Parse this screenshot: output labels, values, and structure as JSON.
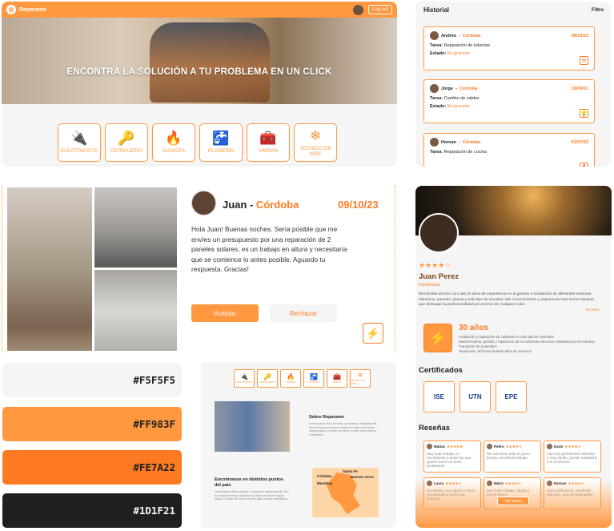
{
  "hero": {
    "brand": "Reparame",
    "logout": "Log out",
    "headline": "ENCONTRA LA SOLUCIÓN A TU PROBLEMA EN UN CLICK",
    "categories": [
      {
        "label": "ELECTRICISTA",
        "icon": "plug-icon",
        "glyph": "🔌"
      },
      {
        "label": "CERRAJERO",
        "icon": "key-icon",
        "glyph": "🔑"
      },
      {
        "label": "GASISTA",
        "icon": "flame-icon",
        "glyph": "🔥"
      },
      {
        "label": "PLOMERO",
        "icon": "faucet-icon",
        "glyph": "🚰"
      },
      {
        "label": "VARIOS",
        "icon": "toolbox-icon",
        "glyph": "🧰"
      },
      {
        "label": "TECNICO DE AIRE",
        "icon": "air-conditioner-icon",
        "glyph": "❄"
      }
    ]
  },
  "historial": {
    "title": "Historial",
    "filter": "Filtro",
    "items": [
      {
        "name": "Andres",
        "city": "Córdoba",
        "date": "08/10/23",
        "task_label": "Tarea:",
        "task": "Reparación de tuberías",
        "status_label": "Estado:",
        "status": "En proceso"
      },
      {
        "name": "Jorge",
        "city": "Córdoba",
        "date": "19/09/23",
        "task_label": "Tarea:",
        "task": "Cambio de cables",
        "status_label": "Estado:",
        "status": "En proceso"
      },
      {
        "name": "Hernan",
        "city": "Córdoba",
        "date": "01/07/23",
        "task_label": "Tarea:",
        "task": "Reparación de cocina",
        "status_label": "Estado:",
        "status": ""
      }
    ]
  },
  "request": {
    "name": "Juan",
    "city": "Córdoba",
    "date": "09/10/23",
    "message": "Hola Juan! Buenas noches. Sería posible que me envíes un presupuesto por una reparación de 2 paneles solares, es un trabajo en altura y necesitaría que se comience lo antes posible. Aguardo tu respuesta. Gracias!",
    "accept": "Aceptar",
    "reject": "Rechazar"
  },
  "profile": {
    "stars": "★★★★☆",
    "name": "Juan Perez",
    "profession": "Electricista",
    "bio": "Electricista técnico con casi 10 años de experiencia en la gestión e instalación de diferentes sistemas eléctricos, paneles, placas y todo tipo de circuitos. Mis conocimientos y experiencia han hecho siempre que destaque la profesionalidad por encima de cualquier cosa.",
    "more": "Ver más",
    "years": "30 años",
    "achievements": [
      "Instalación y reparación de cableado en todo tipo de viviendas",
      "Mantenimiento, gestión y reparación de los sistemas eléctricos instalados por la empresa",
      "Transporte de materiales",
      "Tasaciones, 5d horas durante años de servicios"
    ],
    "certs_title": "Certificados",
    "certs": [
      "ISE",
      "UTN",
      "EPE"
    ],
    "reviews_title": "Reseñas",
    "reviews": [
      {
        "name": "Matias",
        "stars": "★★★★★",
        "text": "Muy buen trabajo, lo recomiendo a todos los que gusten hacer un buen profesional"
      },
      {
        "name": "Pedro",
        "stars": "★★★★☆",
        "text": "Me solucionó todo en poco tiempo. Excelente trabajo"
      },
      {
        "name": "Darío",
        "stars": "★★★★☆",
        "text": "Fue muy profesional, eficiente, y muy rápido. Quedé satisfecho con el servicio"
      },
      {
        "name": "Laura",
        "stars": "★★★★☆",
        "text": "Excelente, muy rápido y eficaz, recomiendo a todos sus servicios"
      },
      {
        "name": "Mario",
        "stars": "★★★★☆",
        "text": "Muy buen trabajo, rápido y precio bueno"
      },
      {
        "name": "Hernan",
        "stars": "★★★★☆",
        "text": "Gran profesional, excelente atención, muy recomendable"
      }
    ],
    "view_all": "Ver todas"
  },
  "palette": [
    {
      "hex": "#F5F5F5",
      "text_color": "#1D1F21"
    },
    {
      "hex": "#FF983F",
      "text_color": "#1D1F21"
    },
    {
      "hex": "#FE7A22",
      "text_color": "#1D1F21"
    },
    {
      "hex": "#1D1F21",
      "text_color": "#F5F5F5"
    }
  ],
  "landing": {
    "categories": [
      "ELECTRICISTA",
      "CERRAJERO",
      "GASISTA",
      "PLOMERO",
      "VARIOS",
      "TECNICO DE AIRE"
    ],
    "about_title": "Sobre Reparame",
    "about_text": "Lorem ipsum dolor sit amet, consectetur adipiscing elit. Sed do eiusmod tempor incididunt ut labore et dolore magna aliqua. Ut enim ad minim veniam, quis nostrud exercitation.",
    "where_title": "Encontranos en distintos puntos del país",
    "where_text": "Lorem ipsum dolor sit amet, consectetur adipiscing elit. Sed do eiusmod tempor incididunt ut labore et dolore magna aliqua. Ut enim ad minim veniam, quis nostrud exercitation.",
    "cities": [
      "Santa Fe",
      "Córdoba",
      "Buenos Aires",
      "Mendoza"
    ]
  }
}
